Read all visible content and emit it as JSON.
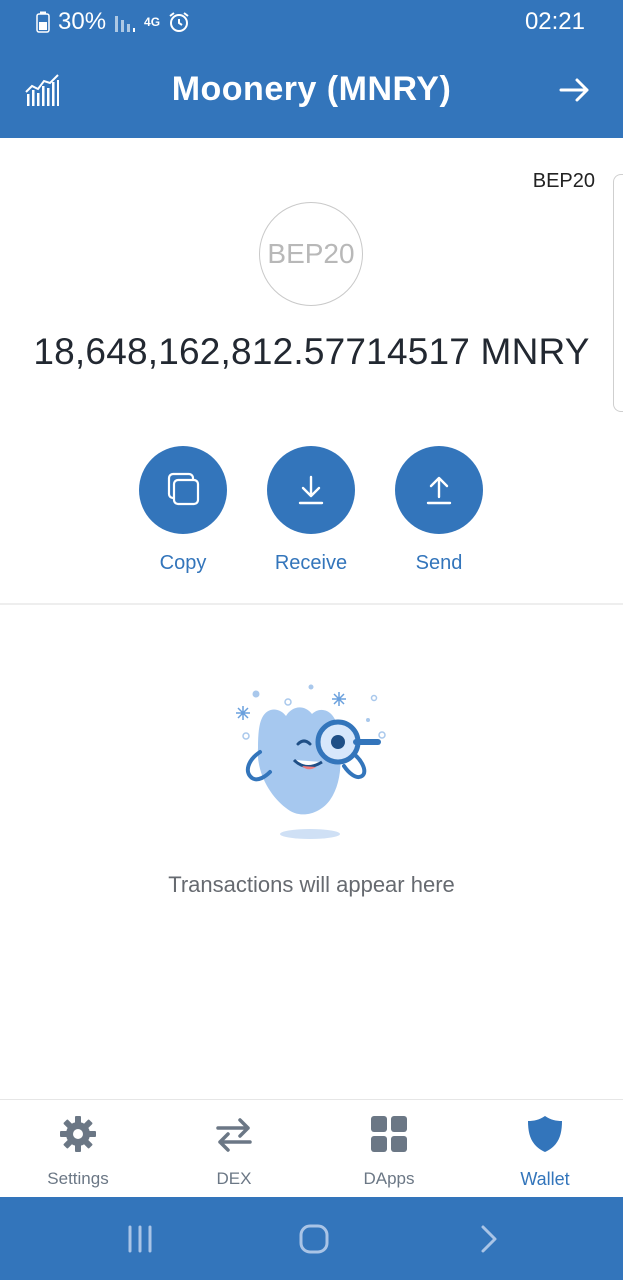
{
  "status_bar": {
    "battery_percent": "30%",
    "network": "4G",
    "time": "02:21"
  },
  "header": {
    "title": "Moonery (MNRY)",
    "left_icon": "chart-icon",
    "right_icon": "arrow-right-icon"
  },
  "token": {
    "network_tag": "BEP20",
    "logo_text": "BEP20",
    "balance": "18,648,162,812.57714517 MNRY"
  },
  "actions": [
    {
      "label": "Copy",
      "icon": "copy-icon"
    },
    {
      "label": "Receive",
      "icon": "download-icon"
    },
    {
      "label": "Send",
      "icon": "upload-icon"
    }
  ],
  "empty_state": {
    "message": "Transactions will appear here",
    "illustration": "mascot-magnifier"
  },
  "bottom_nav": {
    "items": [
      {
        "label": "Settings",
        "icon": "gear-icon",
        "active": false
      },
      {
        "label": "DEX",
        "icon": "swap-icon",
        "active": false
      },
      {
        "label": "DApps",
        "icon": "grid-icon",
        "active": false
      },
      {
        "label": "Wallet",
        "icon": "shield-icon",
        "active": true
      }
    ]
  },
  "colors": {
    "primary": "#3375bb",
    "nav_inactive": "#6b7785",
    "text_dark": "#222831",
    "text_muted": "#666a70"
  }
}
